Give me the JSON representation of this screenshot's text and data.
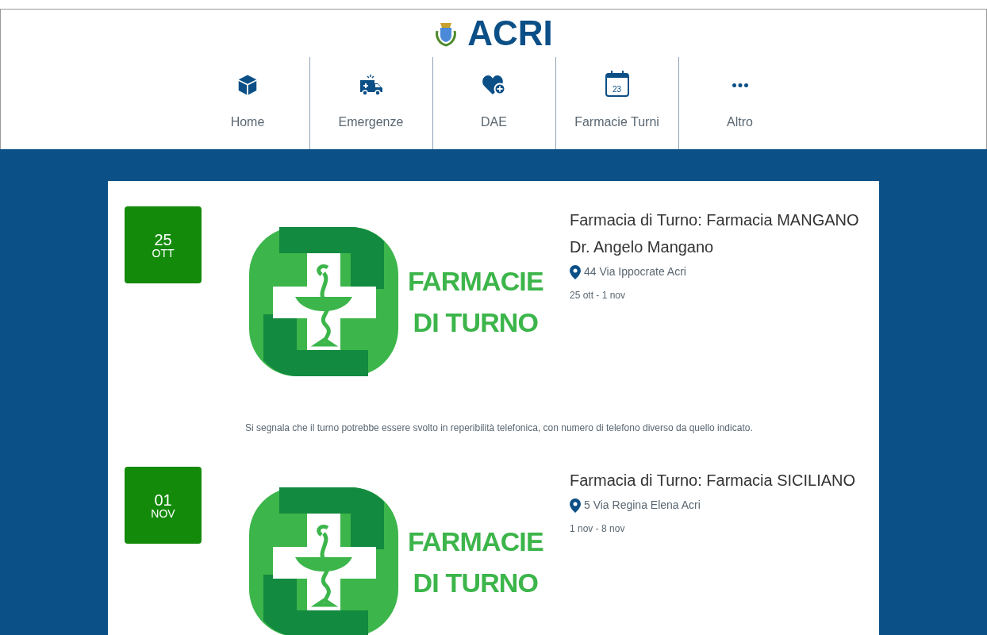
{
  "header": {
    "title": "ACRI"
  },
  "nav": [
    {
      "label": "Home",
      "kind": "cube"
    },
    {
      "label": "Emergenze",
      "kind": "ambulance"
    },
    {
      "label": "DAE",
      "kind": "heart"
    },
    {
      "label": "Farmacie Turni",
      "kind": "calendar",
      "icon_text": "23"
    },
    {
      "label": "Altro",
      "kind": "dots"
    }
  ],
  "entries": [
    {
      "day": "25",
      "month": "OTT",
      "logo_text": [
        "FARMACIE",
        "DI TURNO"
      ],
      "titles": [
        "Farmacia di Turno: Farmacia MANGANO",
        "Dr. Angelo Mangano"
      ],
      "address": "44 Via Ippocrate Acri",
      "dates": "25 ott - 1 nov",
      "note": "Si segnala che il turno potrebbe essere svolto in reperibilità telefonica, con numero di telefono diverso da quello indicato."
    },
    {
      "day": "01",
      "month": "NOV",
      "logo_text": [
        "FARMACIE",
        "DI TURNO"
      ],
      "titles": [
        "Farmacia di Turno: Farmacia SICILIANO"
      ],
      "address": "5 Via Regina Elena Acri",
      "dates": "1 nov - 8 nov"
    }
  ]
}
